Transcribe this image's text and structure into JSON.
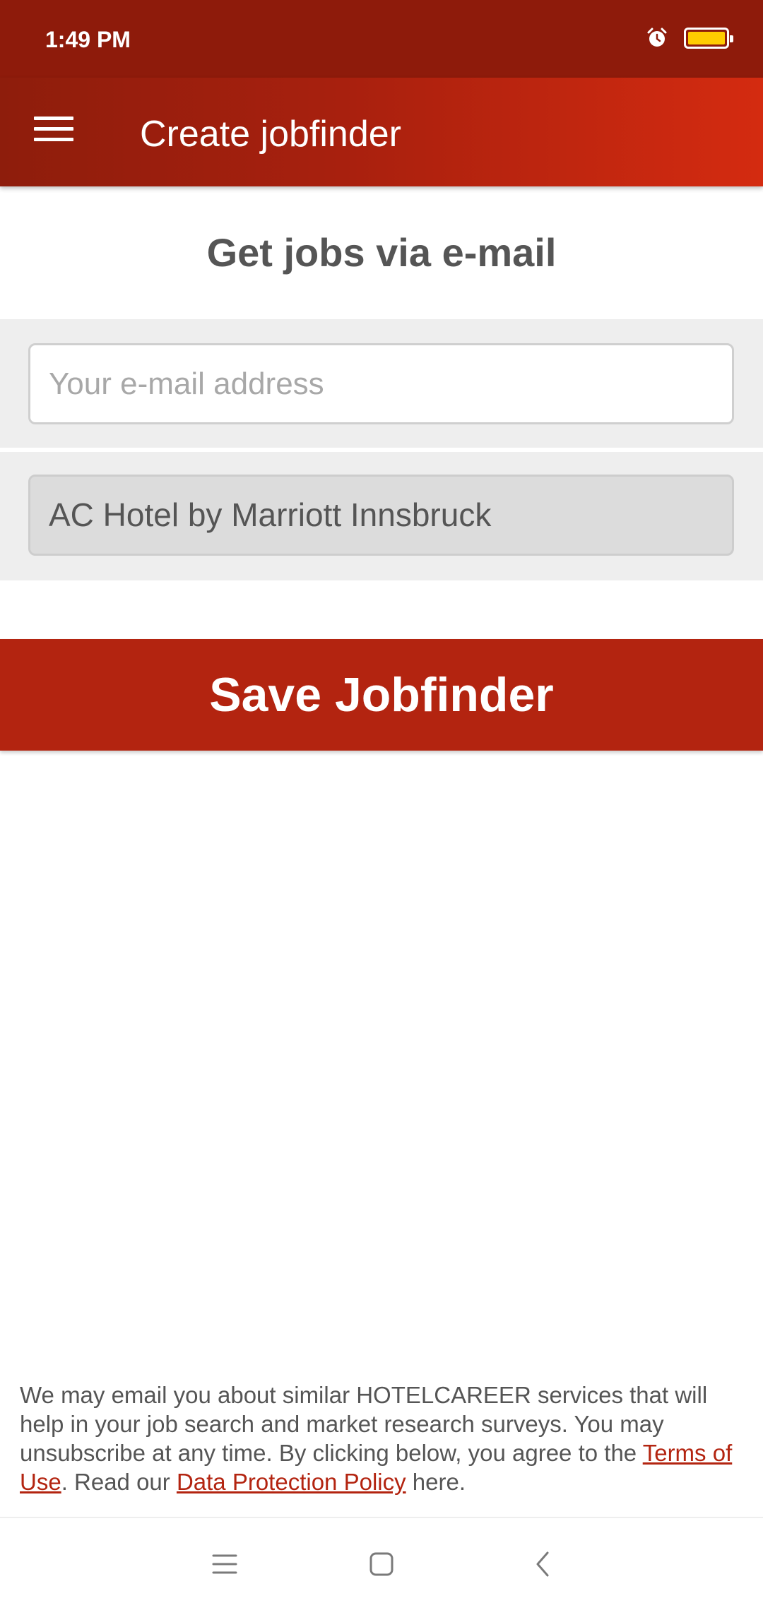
{
  "status_bar": {
    "time": "1:49 PM",
    "icons": [
      "alarm-icon",
      "battery-icon"
    ],
    "battery_color": "#ffcc00"
  },
  "app_bar": {
    "title": "Create jobfinder",
    "menu_icon": "hamburger-menu-icon"
  },
  "main": {
    "heading": "Get jobs via e-mail",
    "email_input": {
      "placeholder": "Your e-mail address",
      "value": ""
    },
    "location_field": {
      "value": "AC Hotel by Marriott Innsbruck"
    },
    "save_button": {
      "label": "Save Jobfinder"
    }
  },
  "disclaimer": {
    "text_before": "We may email you about similar HOTELCAREER services that will help in your job search and market research surveys. You may unsubscribe at any time. By clicking below, you agree to the ",
    "terms_link": "Terms of Use",
    "text_middle": ". Read our ",
    "privacy_link": "Data Protection Policy",
    "text_after": " here."
  },
  "nav_bar": {
    "icons": [
      "recent-apps-icon",
      "home-icon",
      "back-icon"
    ]
  },
  "colors": {
    "primary": "#b32410",
    "status_bar": "#8e1b0b",
    "text": "#555555"
  }
}
